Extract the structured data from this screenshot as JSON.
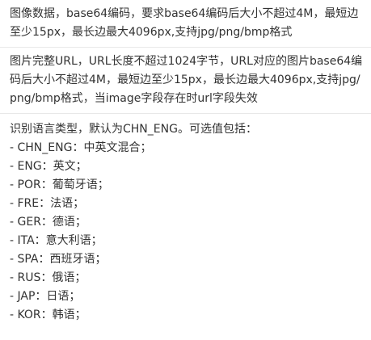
{
  "rows": [
    {
      "text": "图像数据，base64编码，要求base64编码后大小不超过4M，最短边至少15px，最长边最大4096px,支持jpg/png/bmp格式"
    },
    {
      "text": "图片完整URL，URL长度不超过1024字节，URL对应的图片base64编码后大小不超过4M，最短边至少15px，最长边最大4096px,支持jpg/png/bmp格式，当image字段存在时url字段失效"
    }
  ],
  "language": {
    "intro": "识别语言类型，默认为CHN_ENG。可选值包括：",
    "options": [
      "- CHN_ENG：中英文混合；",
      "- ENG：英文；",
      "- POR：葡萄牙语；",
      "- FRE：法语；",
      "- GER：德语；",
      "- ITA：意大利语；",
      "- SPA：西班牙语；",
      "- RUS：俄语；",
      "- JAP：日语；",
      "- KOR：韩语；"
    ]
  }
}
